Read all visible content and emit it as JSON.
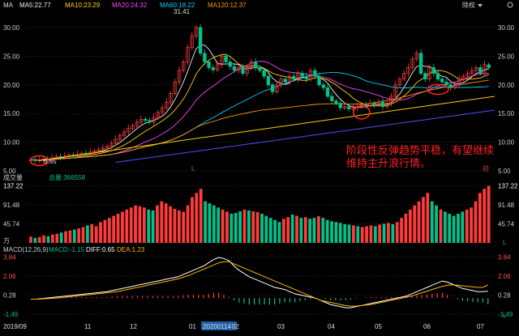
{
  "colors": {
    "up": "#ff3b3b",
    "down": "#00c28a",
    "ma5": "#f0f0f0",
    "ma10": "#ffd200",
    "ma20": "#ff40ff",
    "ma60": "#00d0ff",
    "ma120": "#ff9a00",
    "ma250": "#4a50ff",
    "ma250_color_note": "",
    "macd_diff": "#ffffff",
    "macd_dea": "#ffb400",
    "annotation": "#ff2020",
    "grid": "#2a2a2a",
    "trendline": "#ffd000"
  },
  "header": {
    "title": "MA",
    "ma5": "MA5:22.77",
    "ma10": "MA10:23.29",
    "ma20": "MA20:24.32",
    "ma60": "MA60:18.22",
    "ma120": "MA120:12.37",
    "right_label": "除权",
    "max_label": "31.41",
    "min_label": "6.65"
  },
  "volume_panel": {
    "title": "成交量",
    "total_label": "总量:366558",
    "unit": "万"
  },
  "macd_panel": {
    "title": "MACD(12,26,9)",
    "macd_label": "MACD:-1.15",
    "diff_label": "DIFF:0.65",
    "dea_label": "DEA:1.23"
  },
  "annotation": {
    "line1": "阶段性反弹趋势平稳，有望继续",
    "line2": "维持主升浪行情。"
  },
  "icons": {
    "watermark_mid": "L",
    "watermark_right": "趋",
    "watermark_vol": "L",
    "watermark_macd": "L"
  },
  "chart_data": [
    {
      "type": "candlestick",
      "name": "price",
      "y_ticks": [
        "30.00",
        "25.00",
        "20.00",
        "15.00",
        "10.00",
        "5.00"
      ],
      "y_tick_values": [
        30,
        25,
        20,
        15,
        10,
        5
      ],
      "ylim": [
        4.6,
        32.8
      ],
      "x_tick_labels": [
        "2019/09",
        "11",
        "12",
        "01",
        "20200114",
        "02",
        "03",
        "04",
        "05",
        "06",
        "07"
      ],
      "closes": [
        7.0,
        6.8,
        6.9,
        7.1,
        7.0,
        7.3,
        7.5,
        7.4,
        7.6,
        7.8,
        7.7,
        7.9,
        8.1,
        8.0,
        8.3,
        8.5,
        8.7,
        9.0,
        9.3,
        9.8,
        10.5,
        11.2,
        11.8,
        12.4,
        12.9,
        13.5,
        14.0,
        13.8,
        13.5,
        14.3,
        15.2,
        16.0,
        17.0,
        18.5,
        20.5,
        22.5,
        24.0,
        26.5,
        28.5,
        30.0,
        25.5,
        24.0,
        23.0,
        22.6,
        23.5,
        25.0,
        24.0,
        23.2,
        22.5,
        23.0,
        22.0,
        23.0,
        24.0,
        23.0,
        22.5,
        21.5,
        20.0,
        18.8,
        20.0,
        21.0,
        20.5,
        21.5,
        21.0,
        22.0,
        21.5,
        21.0,
        22.5,
        21.5,
        20.0,
        19.5,
        18.0,
        17.2,
        16.8,
        16.0,
        16.2,
        15.8,
        16.0,
        16.2,
        16.5,
        16.4,
        16.8,
        16.5,
        17.0,
        16.2,
        16.8,
        18.0,
        20.0,
        21.0,
        22.0,
        23.0,
        24.5,
        25.5,
        22.0,
        21.0,
        23.0,
        22.0,
        21.0,
        20.5,
        20.0,
        19.5,
        20.0,
        21.0,
        21.5,
        22.0,
        22.5,
        23.0,
        22.0,
        23.5,
        23.0
      ],
      "ma_series": [
        "MA5",
        "MA10",
        "MA20",
        "MA60",
        "MA120"
      ]
    },
    {
      "type": "bar",
      "name": "volume",
      "y_ticks": [
        "137.22",
        "91.48",
        "45.74"
      ],
      "y_tick_values": [
        137.22,
        91.48,
        45.74
      ],
      "ylim": [
        0,
        140
      ],
      "values": [
        15,
        12,
        14,
        18,
        16,
        20,
        22,
        25,
        28,
        30,
        32,
        35,
        38,
        42,
        45,
        40,
        50,
        55,
        60,
        65,
        70,
        75,
        80,
        85,
        90,
        88,
        85,
        80,
        78,
        90,
        100,
        95,
        88,
        82,
        78,
        75,
        90,
        110,
        120,
        130,
        100,
        95,
        90,
        85,
        80,
        75,
        70,
        72,
        76,
        80,
        78,
        76,
        74,
        70,
        65,
        60,
        55,
        50,
        58,
        62,
        68,
        65,
        60,
        62,
        58,
        60,
        64,
        60,
        55,
        52,
        50,
        48,
        45,
        44,
        42,
        40,
        38,
        40,
        42,
        40,
        44,
        46,
        48,
        45,
        50,
        60,
        70,
        80,
        90,
        100,
        110,
        120,
        100,
        90,
        80,
        75,
        70,
        65,
        70,
        75,
        80,
        85,
        100,
        120,
        130,
        137
      ]
    },
    {
      "type": "line",
      "name": "MACD",
      "y_ticks": [
        "3.84",
        "2.06",
        "0.28",
        "-1.49"
      ],
      "y_tick_values": [
        3.84,
        2.06,
        0.28,
        -1.49
      ],
      "ylim": [
        -1.8,
        4.1
      ],
      "series": [
        {
          "name": "DIFF",
          "values": [
            -0.1,
            -0.1,
            -0.05,
            0.0,
            0.05,
            0.1,
            0.15,
            0.2,
            0.25,
            0.3,
            0.35,
            0.4,
            0.45,
            0.5,
            0.55,
            0.6,
            0.7,
            0.8,
            0.9,
            1.0,
            1.1,
            1.2,
            1.3,
            1.4,
            1.5,
            1.6,
            1.7,
            1.8,
            1.9,
            2.0,
            2.2,
            2.4,
            2.6,
            2.8,
            3.0,
            3.3,
            3.6,
            3.8,
            3.7,
            3.5,
            3.0,
            2.6,
            2.3,
            2.0,
            1.8,
            1.6,
            1.4,
            1.2,
            1.0,
            0.9,
            0.8,
            0.6,
            0.4,
            0.3,
            0.2,
            0.1,
            0.0,
            -0.2,
            -0.4,
            -0.6,
            -0.7,
            -0.8,
            -0.9,
            -0.9,
            -0.8,
            -0.7,
            -0.6,
            -0.5,
            -0.4,
            -0.3,
            -0.2,
            -0.1,
            0.0,
            0.1,
            0.2,
            0.4,
            0.6,
            0.8,
            1.0,
            1.2,
            1.4,
            1.6,
            1.5,
            1.3,
            1.1,
            0.9,
            0.8,
            0.7,
            0.6,
            0.6,
            0.65
          ]
        },
        {
          "name": "DEA",
          "values": [
            -0.1,
            -0.1,
            -0.08,
            -0.05,
            -0.02,
            0.0,
            0.05,
            0.1,
            0.15,
            0.2,
            0.25,
            0.3,
            0.35,
            0.4,
            0.45,
            0.5,
            0.55,
            0.6,
            0.7,
            0.8,
            0.9,
            1.0,
            1.1,
            1.2,
            1.3,
            1.4,
            1.5,
            1.6,
            1.7,
            1.8,
            1.95,
            2.1,
            2.3,
            2.5,
            2.7,
            2.9,
            3.1,
            3.3,
            3.4,
            3.4,
            3.2,
            3.0,
            2.8,
            2.6,
            2.4,
            2.2,
            2.0,
            1.8,
            1.6,
            1.4,
            1.2,
            1.0,
            0.8,
            0.6,
            0.4,
            0.2,
            0.0,
            -0.2,
            -0.3,
            -0.4,
            -0.5,
            -0.6,
            -0.7,
            -0.75,
            -0.75,
            -0.7,
            -0.65,
            -0.6,
            -0.5,
            -0.4,
            -0.3,
            -0.2,
            -0.1,
            0.0,
            0.1,
            0.2,
            0.35,
            0.5,
            0.65,
            0.8,
            0.95,
            1.1,
            1.2,
            1.25,
            1.2,
            1.15,
            1.1,
            1.05,
            1.0,
            1.0,
            1.23
          ]
        }
      ],
      "bars": [
        0.0,
        0.0,
        0.03,
        0.05,
        0.07,
        0.1,
        0.1,
        0.1,
        0.1,
        0.1,
        0.1,
        0.1,
        0.1,
        0.1,
        0.1,
        0.1,
        0.15,
        0.2,
        0.2,
        0.2,
        0.2,
        0.2,
        0.2,
        0.2,
        0.2,
        0.2,
        0.2,
        0.2,
        0.2,
        0.2,
        0.25,
        0.3,
        0.3,
        0.3,
        0.3,
        0.4,
        0.5,
        0.5,
        0.3,
        0.1,
        -0.2,
        -0.4,
        -0.5,
        -0.6,
        -0.6,
        -0.6,
        -0.6,
        -0.6,
        -0.6,
        -0.5,
        -0.4,
        -0.4,
        -0.4,
        -0.3,
        -0.2,
        -0.1,
        0.0,
        0.0,
        -0.1,
        -0.2,
        -0.2,
        -0.2,
        -0.2,
        -0.15,
        -0.05,
        0.0,
        0.05,
        0.1,
        0.1,
        0.1,
        0.1,
        0.1,
        0.1,
        0.1,
        0.1,
        0.2,
        0.25,
        0.3,
        0.35,
        0.4,
        0.45,
        0.5,
        0.3,
        0.05,
        -0.1,
        -0.25,
        -0.3,
        -0.35,
        -0.4,
        -0.4,
        -0.58
      ]
    }
  ]
}
